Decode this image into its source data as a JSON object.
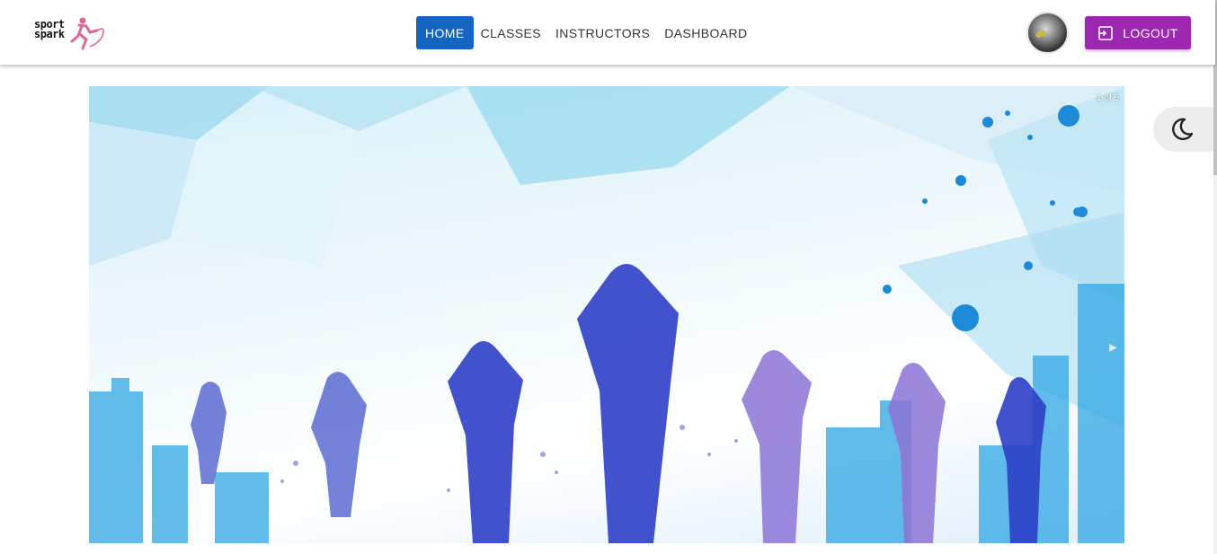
{
  "brand": {
    "line1": "sport",
    "line2": "spark",
    "accent_color": "#e0688f"
  },
  "nav": {
    "items": [
      {
        "label": "HOME",
        "active": true
      },
      {
        "label": "CLASSES",
        "active": false
      },
      {
        "label": "INSTRUCTORS",
        "active": false
      },
      {
        "label": "DASHBOARD",
        "active": false
      }
    ],
    "active_color": "#1565c0"
  },
  "user": {
    "avatar_icon": "user-avatar"
  },
  "logout": {
    "label": "LOGOUT",
    "icon": "logout-icon",
    "color": "#9c27b0"
  },
  "theme_toggle": {
    "icon": "moon-icon"
  },
  "carousel": {
    "counter": "1 of 5",
    "next_icon": "chevron-right-icon"
  }
}
